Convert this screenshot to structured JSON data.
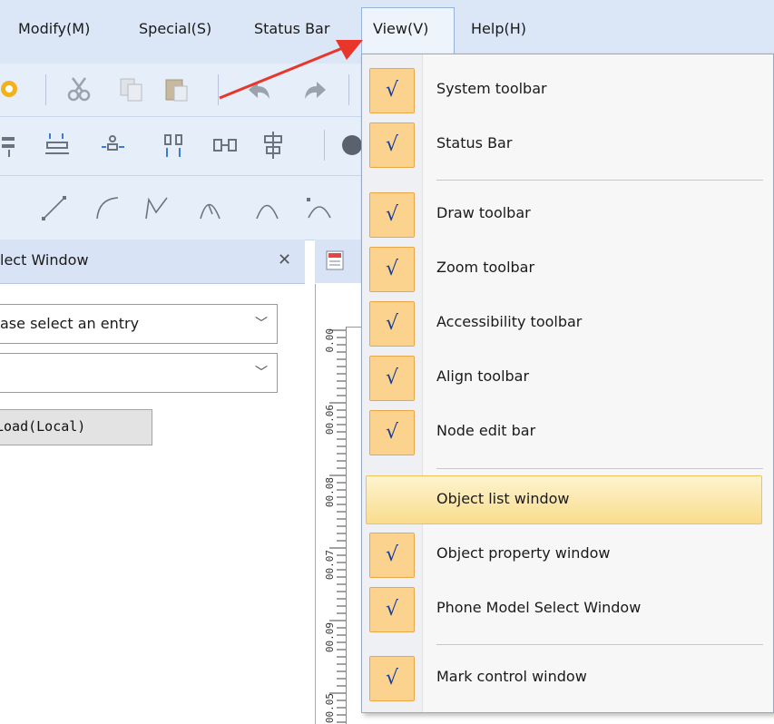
{
  "menubar": {
    "items": [
      {
        "label": "Modify(M)"
      },
      {
        "label": "Special(S)"
      },
      {
        "label": "Status Bar"
      },
      {
        "label": "View(V)"
      },
      {
        "label": "Help(H)"
      }
    ]
  },
  "select_window": {
    "title": "lect Window",
    "close_glyph": "✕",
    "combo1_value": "ase select an entry",
    "combo2_value": "",
    "arrow_glyph": "﹀",
    "load_button": "Load(Local)"
  },
  "canvas": {
    "ruler_labels": [
      "0.00",
      "00.06",
      "00.08",
      "00.07",
      "00.09",
      "00.05"
    ]
  },
  "view_menu": {
    "check_glyph": "√",
    "items": [
      {
        "label": "System toolbar",
        "checked": true
      },
      {
        "label": "Status Bar",
        "checked": true
      },
      {
        "label": "Draw toolbar",
        "checked": true
      },
      {
        "label": "Zoom toolbar",
        "checked": true
      },
      {
        "label": "Accessibility toolbar",
        "checked": true
      },
      {
        "label": "Align toolbar",
        "checked": true
      },
      {
        "label": "Node edit bar",
        "checked": true
      },
      {
        "label": "Object list window",
        "checked": false,
        "highlighted": true
      },
      {
        "label": "Object property window",
        "checked": true
      },
      {
        "label": "Phone Model Select Window",
        "checked": true
      },
      {
        "label": "Mark control window",
        "checked": true
      }
    ]
  },
  "colors": {
    "checkbox_bg": "#fcd38e",
    "checkbox_border": "#e9a646",
    "highlight": "#f9dc8d",
    "arrow": "#e8362b"
  },
  "icons": [
    "gear-icon",
    "cut-icon",
    "copy-icon",
    "paste-icon",
    "undo-icon",
    "redo-icon",
    "align-top-icon",
    "distribute-vertical-icon",
    "distribute-center-icon",
    "align-center-icon",
    "equal-spacing-icon",
    "align-middle-icon",
    "line-icon",
    "arc-icon",
    "bezier-icon",
    "curve-icon",
    "zoom-icon",
    "document-icon"
  ]
}
